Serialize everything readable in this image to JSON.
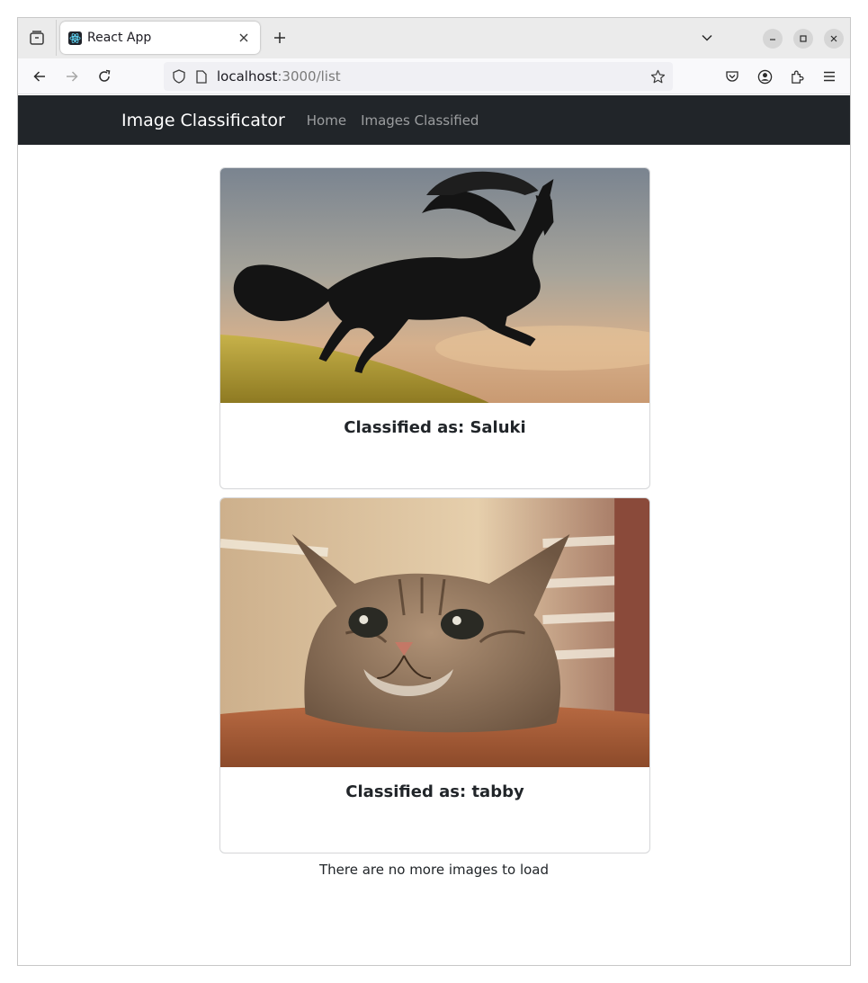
{
  "browser": {
    "tab_title": "React App",
    "url_host": "localhost",
    "url_path": ":3000/list"
  },
  "app": {
    "brand": "Image Classificator",
    "nav_links": [
      "Home",
      "Images Classified"
    ]
  },
  "cards": [
    {
      "title": "Classified as: Saluki",
      "image": "horse-photo"
    },
    {
      "title": "Classified as: tabby",
      "image": "cat-photo"
    }
  ],
  "end_message": "There are no more images to load",
  "colors": {
    "navbar_bg": "#212529",
    "browser_chrome": "#ebebeb"
  }
}
